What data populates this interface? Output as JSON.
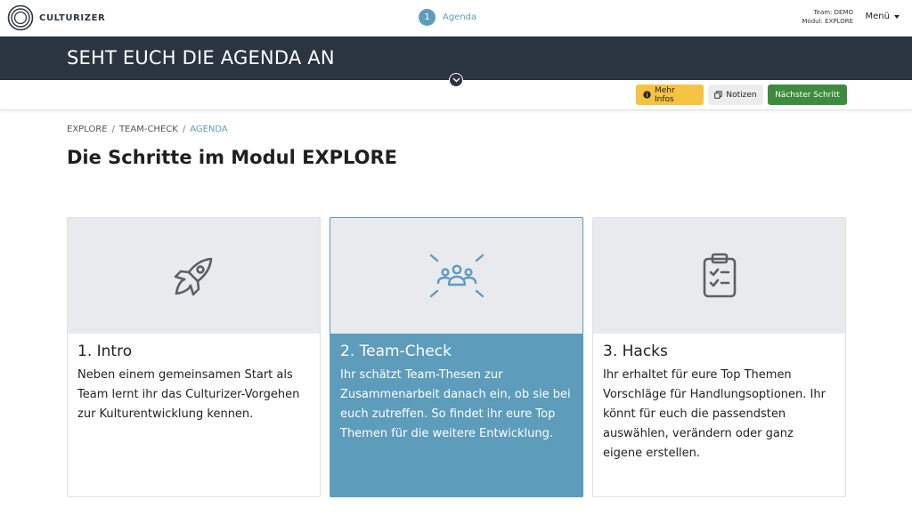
{
  "header": {
    "logo_text": "CULTURIZER",
    "stepper": {
      "number": "1",
      "label": "Agenda"
    },
    "team_line": "Team: DEMO",
    "module_line": "Modul: EXPLORE",
    "menu_label": "Menü"
  },
  "hero": {
    "title": "SEHT EUCH DIE AGENDA AN"
  },
  "toolbar": {
    "info_label": "Mehr Infos",
    "notes_label": "Notizen",
    "next_label": "Nächster Schritt"
  },
  "breadcrumb": [
    "EXPLORE",
    "TEAM-CHECK",
    "AGENDA"
  ],
  "page_title": "Die Schritte im Modul EXPLORE",
  "cards": [
    {
      "icon": "rocket-icon",
      "title": "1. Intro",
      "text": "Neben einem gemeinsamen Start als Team lernt ihr das Culturizer-Vorgehen zur Kulturentwicklung kennen."
    },
    {
      "icon": "team-icon",
      "title": "2. Team-Check",
      "text": "Ihr schätzt Team-Thesen zur Zusammenarbeit danach ein, ob sie bei euch zutreffen. So findet ihr eure Top Themen für die weitere Entwicklung."
    },
    {
      "icon": "clipboard-icon",
      "title": "3. Hacks",
      "text": "Ihr erhaltet für eure Top Themen Vorschläge für Handlungsoptionen. Ihr könnt für euch die passendsten auswählen, verändern oder ganz eigene erstellen."
    }
  ],
  "colors": {
    "header_dark": "#2b3441",
    "accent_blue": "#5d9cbb",
    "info_yellow": "#f5c242",
    "next_green": "#3d8b3d",
    "card_media_gray": "#e9eaee"
  }
}
